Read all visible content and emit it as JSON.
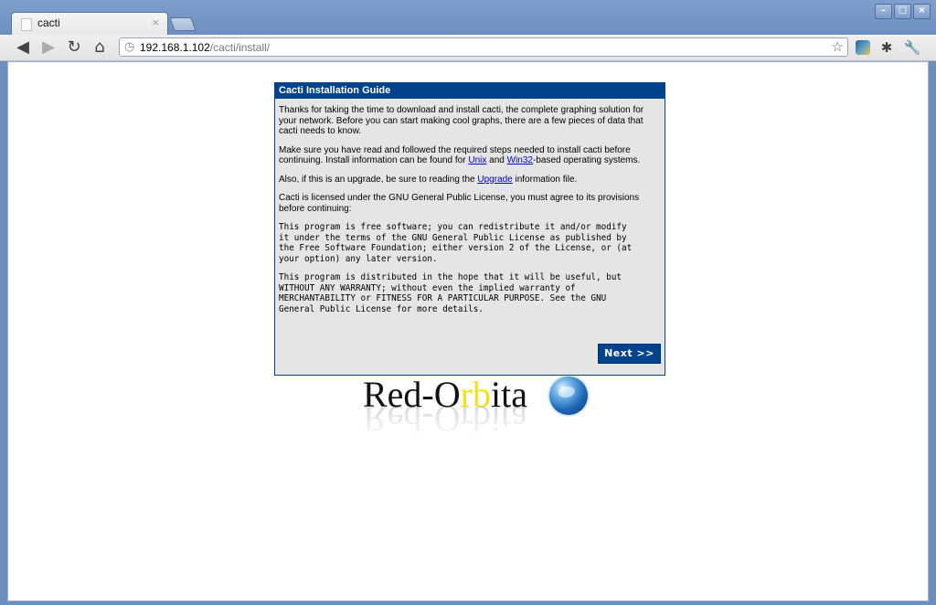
{
  "browser": {
    "tab_title": "cacti",
    "tab_close": "×",
    "url_host": "192.168.1.102",
    "url_path": "/cacti/install/",
    "window_buttons": [
      "–",
      "□",
      "×"
    ]
  },
  "guide": {
    "header": "Cacti Installation Guide",
    "para1": "Thanks for taking the time to download and install cacti, the complete graphing solution for your network. Before you can start making cool graphs, there are a few pieces of data that cacti needs to know.",
    "para2_a": "Make sure you have read and followed the required steps needed to install cacti before continuing. Install information can be found for ",
    "link_unix": "Unix",
    "para2_b": " and ",
    "link_win32": "Win32",
    "para2_c": "-based operating systems.",
    "para3_a": "Also, if this is an upgrade, be sure to reading the ",
    "link_upgrade": "Upgrade",
    "para3_b": " information file.",
    "para4": "Cacti is licensed under the GNU General Public License, you must agree to its provisions before continuing:",
    "license1": "This program is free software; you can redistribute it and/or modify\nit under the terms of the GNU General Public License as published by\nthe Free Software Foundation; either version 2 of the License, or (at\nyour option) any later version.",
    "license2": "This program is distributed in the hope that it will be useful, but\nWITHOUT ANY WARRANTY; without even the implied warranty of\nMERCHANTABILITY or FITNESS FOR A PARTICULAR PURPOSE. See the GNU\nGeneral Public License for more details.",
    "next_label": "Next >>"
  },
  "logo": {
    "part1": "Red-O",
    "part2": "rb",
    "part3": "ita",
    "reflection": "Red-Orbita"
  },
  "colors": {
    "accent": "#00438c",
    "panel_bg": "#e5e5e5",
    "link": "#0000cc"
  }
}
